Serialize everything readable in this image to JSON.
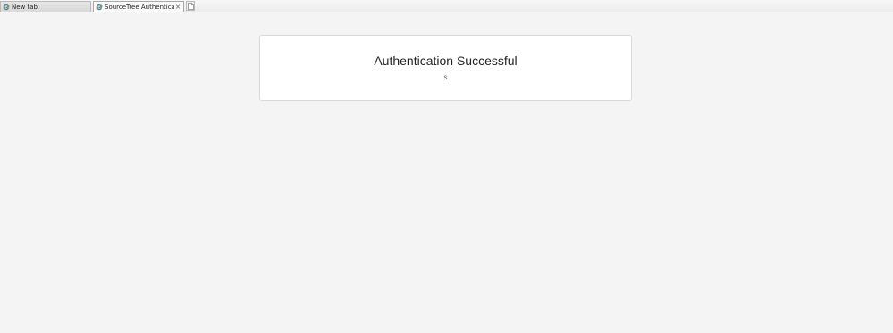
{
  "browser": {
    "tabs": [
      {
        "label": "New tab",
        "active": false,
        "icon": "ie-globe-icon"
      },
      {
        "label": "SourceTree Authentication",
        "active": true,
        "icon": "ie-globe-icon",
        "close_symbol": "×"
      }
    ],
    "new_tab_icon": "new-page-icon"
  },
  "page": {
    "title": "Authentication Successful",
    "subtitle": "s"
  },
  "colors": {
    "background": "#f4f4f4",
    "card_background": "#ffffff",
    "card_border": "#d9d9d9",
    "ie_icon_blue": "#2a7fd4",
    "ie_icon_ring": "#f2b21a"
  }
}
